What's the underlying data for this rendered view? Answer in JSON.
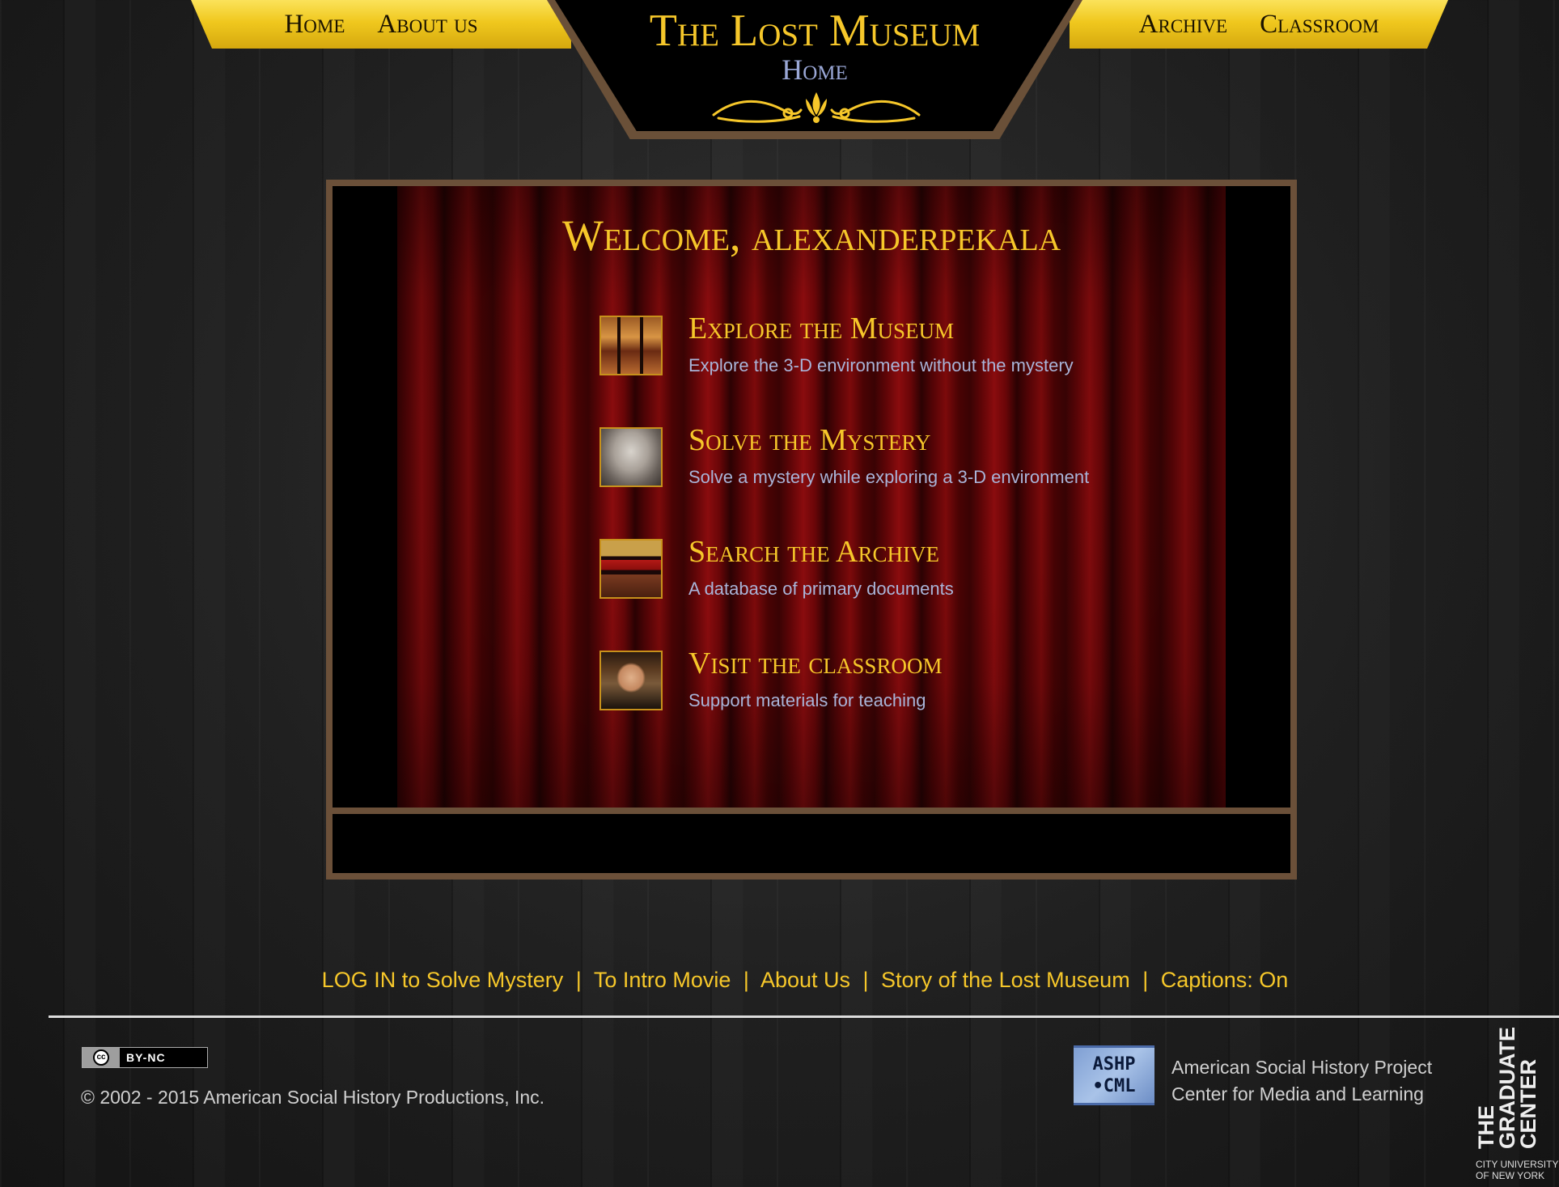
{
  "nav": {
    "left": [
      {
        "label": "Home"
      },
      {
        "label": "About us"
      }
    ],
    "right": [
      {
        "label": "Archive"
      },
      {
        "label": "Classroom"
      }
    ]
  },
  "header": {
    "title": "The Lost Museum",
    "subtitle": "Home"
  },
  "main": {
    "welcome": "Welcome, alexanderpekala",
    "items": [
      {
        "title": "Explore the Museum",
        "description": "Explore the 3-D environment without the mystery",
        "thumb": "museum-room-image"
      },
      {
        "title": "Solve the Mystery",
        "description": "Solve a mystery while exploring a 3-D environment",
        "thumb": "barnum-face-image"
      },
      {
        "title": "Search the Archive",
        "description": "A database of primary documents",
        "thumb": "archive-desk-image"
      },
      {
        "title": "Visit the classroom",
        "description": "Support materials for teaching",
        "thumb": "teacher-portrait-image"
      }
    ]
  },
  "footer": {
    "links": [
      "LOG IN to Solve Mystery",
      "To Intro Movie",
      "About Us",
      "Story of the Lost Museum",
      "Captions: On"
    ],
    "separator": "|",
    "cc_label": "BY-NC",
    "cc_symbol": "cc",
    "copyright": "© 2002 - 2015 American Social History Productions, Inc.",
    "ashp_logo_lines": [
      "ASHP",
      "•CML"
    ],
    "ashp_text_lines": [
      "American Social History Project",
      "Center for Media and Learning"
    ],
    "gc_lines": [
      "THE",
      "GRADUATE",
      "CENTER"
    ],
    "gc_sub_lines": [
      "CITY UNIVERSITY",
      "OF NEW YORK"
    ]
  },
  "colors": {
    "gold": "#f6c72a",
    "curtain_red": "#8a0c0e",
    "frame_brown": "#6b5039",
    "desc_blue": "#a9b4d8"
  }
}
